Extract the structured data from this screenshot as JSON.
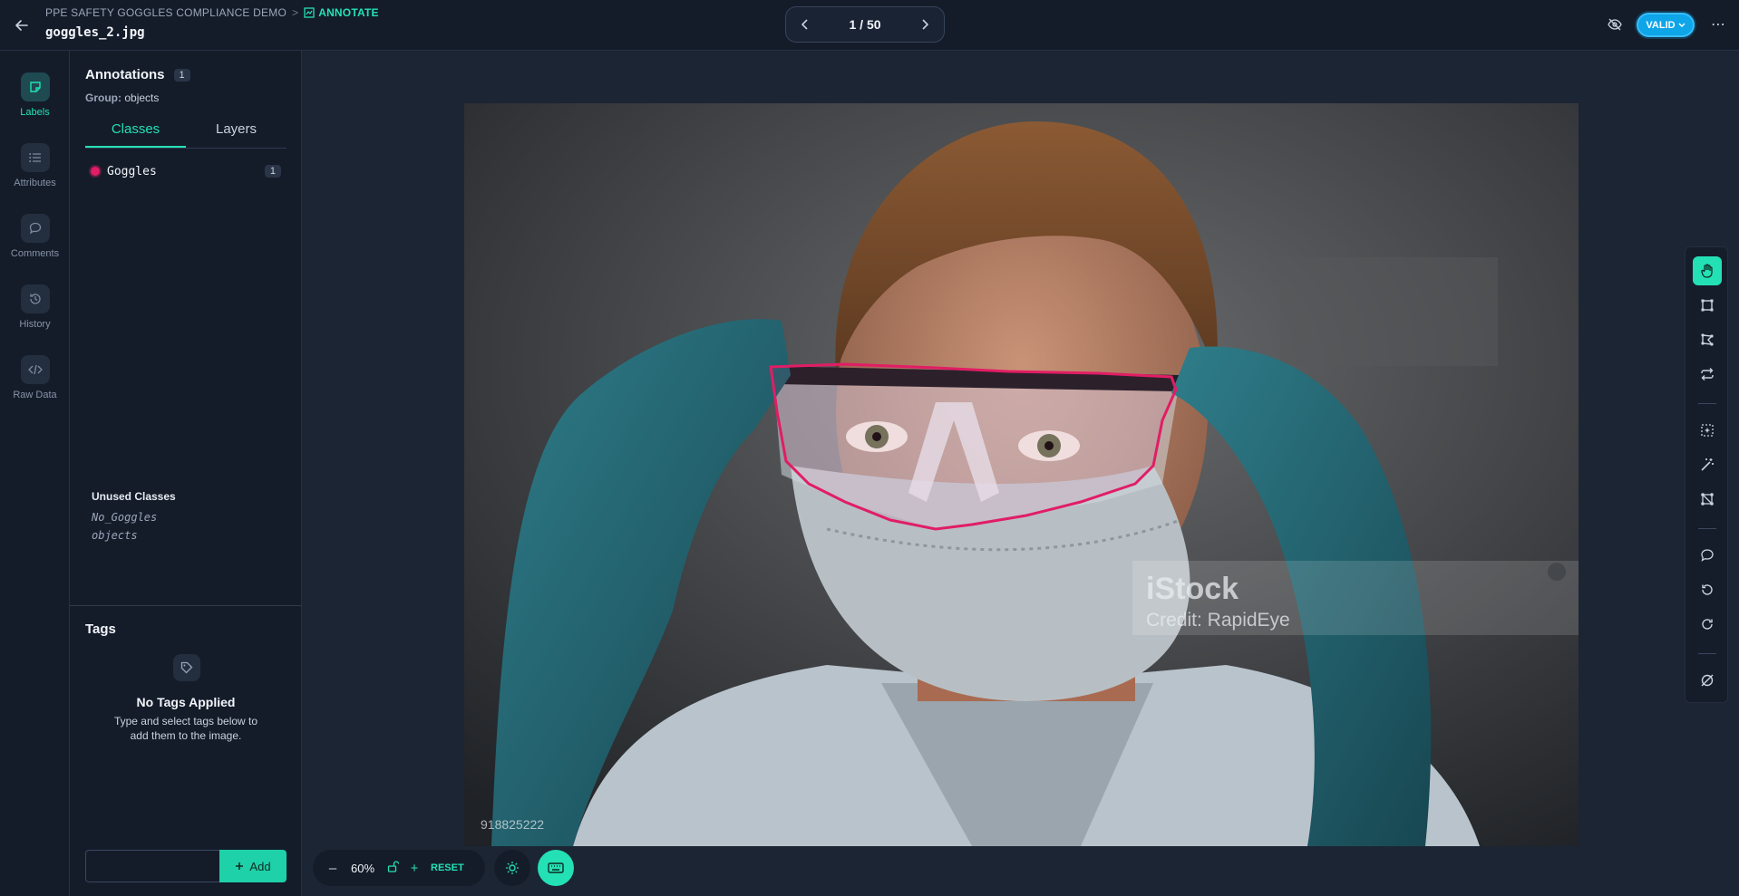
{
  "header": {
    "project": "PPE SAFETY GOGGLES COMPLIANCE DEMO",
    "separator": ">",
    "mode": "ANNOTATE",
    "filename": "goggles_2.jpg",
    "pager": "1 / 50",
    "status": "VALID",
    "more": "⋯"
  },
  "nav": {
    "items": [
      {
        "label": "Labels",
        "icon": "label-icon",
        "active": true
      },
      {
        "label": "Attributes",
        "icon": "list-icon"
      },
      {
        "label": "Comments",
        "icon": "comment-icon"
      },
      {
        "label": "History",
        "icon": "history-icon"
      },
      {
        "label": "Raw Data",
        "icon": "code-icon"
      }
    ]
  },
  "panel": {
    "title": "Annotations",
    "count": "1",
    "group_label": "Group:",
    "group_value": "objects",
    "tabs": [
      "Classes",
      "Layers"
    ],
    "classes": [
      {
        "name": "Goggles",
        "count": "1",
        "color": "#e11d65"
      }
    ],
    "unused_title": "Unused Classes",
    "unused": [
      "No_Goggles",
      "objects"
    ]
  },
  "tags": {
    "title": "Tags",
    "empty_title": "No Tags Applied",
    "empty_sub": "Type and select tags below to add them to the image.",
    "input_value": "",
    "add_label": "Add"
  },
  "image": {
    "watermark_brand": "iStock",
    "watermark_credit": "Credit: RapidEye",
    "stock_id": "918825222"
  },
  "zoom": {
    "minus": "–",
    "value": "60%",
    "plus": "+",
    "reset": "RESET"
  },
  "colors": {
    "accent": "#24e1b5",
    "annotation": "#e11d65",
    "valid": "#0ea5e9"
  }
}
